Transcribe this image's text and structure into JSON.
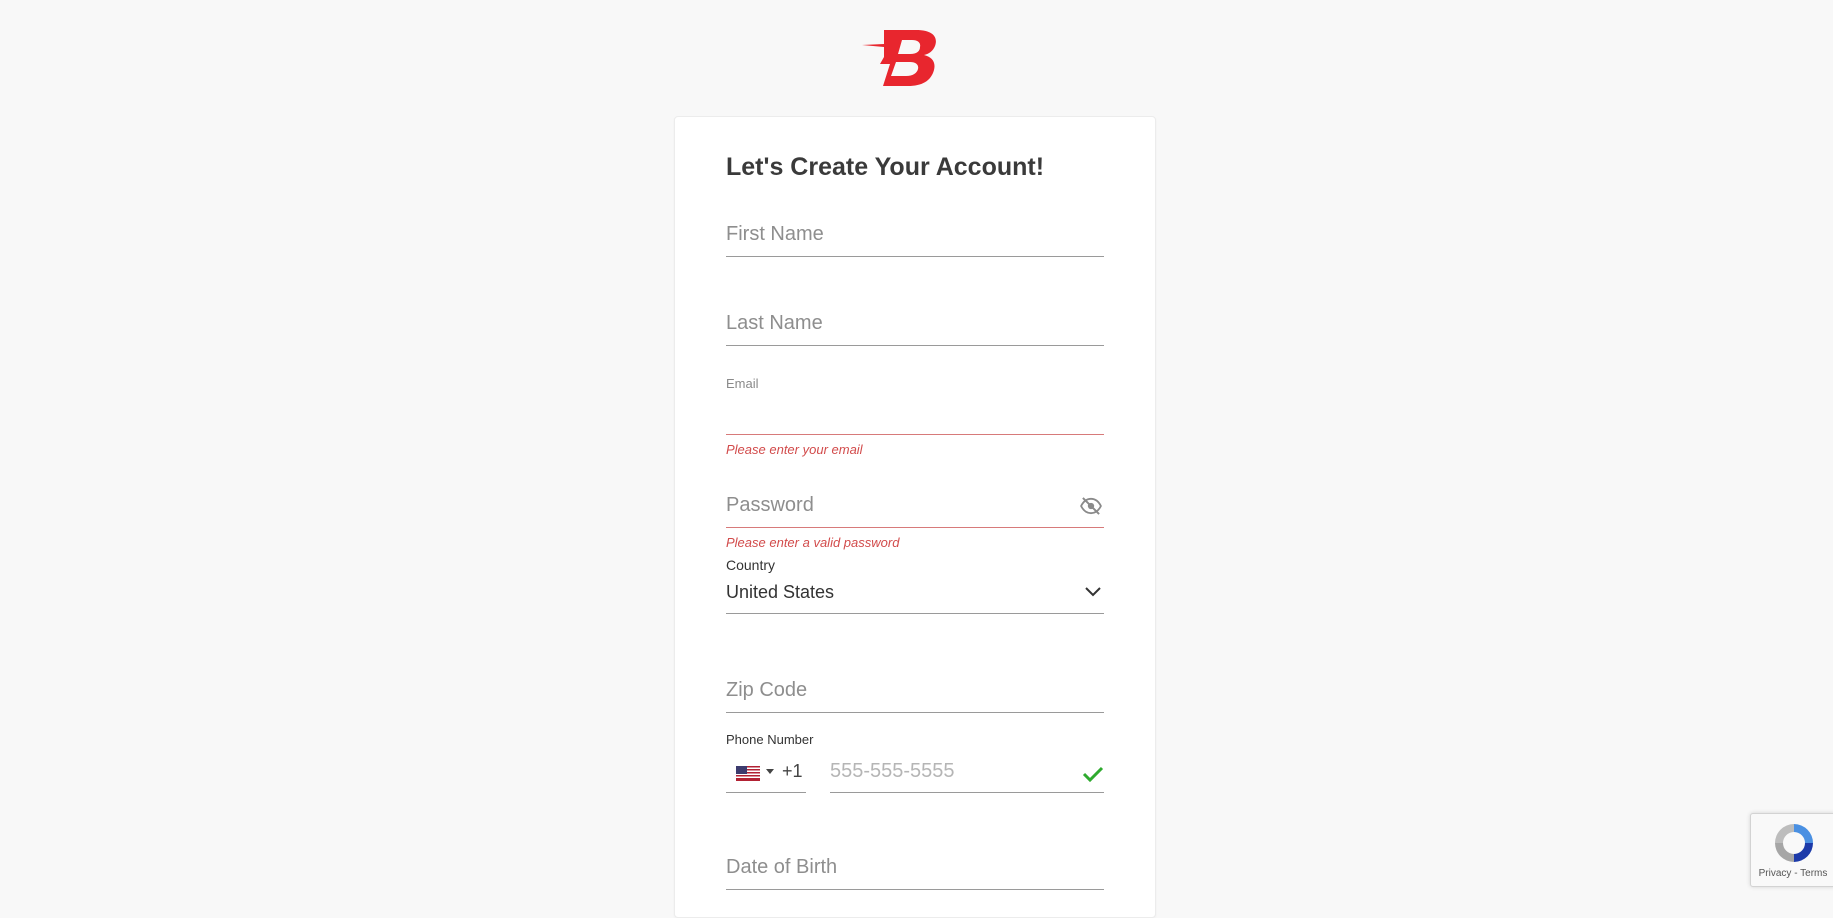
{
  "brand": {
    "logo_letter": "B",
    "accent_color": "#e8262e"
  },
  "form": {
    "title": "Let's Create Your Account!",
    "first_name": {
      "placeholder": "First Name",
      "value": ""
    },
    "last_name": {
      "placeholder": "Last Name",
      "value": ""
    },
    "email": {
      "label": "Email",
      "value": "",
      "error": "Please enter your email"
    },
    "password": {
      "placeholder": "Password",
      "value": "",
      "error": "Please enter a valid password",
      "toggle_icon": "eye-slash-icon"
    },
    "country": {
      "label": "Country",
      "value": "United States",
      "icon": "chevron-down-icon"
    },
    "zip_code": {
      "placeholder": "Zip Code",
      "value": ""
    },
    "phone": {
      "label": "Phone Number",
      "country_flag": "us-flag-icon",
      "dial_code": "+1",
      "placeholder": "555-555-5555",
      "value": "",
      "valid_icon": "check-icon"
    },
    "date_of_birth": {
      "placeholder": "Date of Birth",
      "value": ""
    }
  },
  "colors": {
    "error": "#d24b4b",
    "success": "#2eaa2e",
    "text_muted": "#8e8e8e"
  },
  "recaptcha": {
    "links": "Privacy - Terms"
  }
}
